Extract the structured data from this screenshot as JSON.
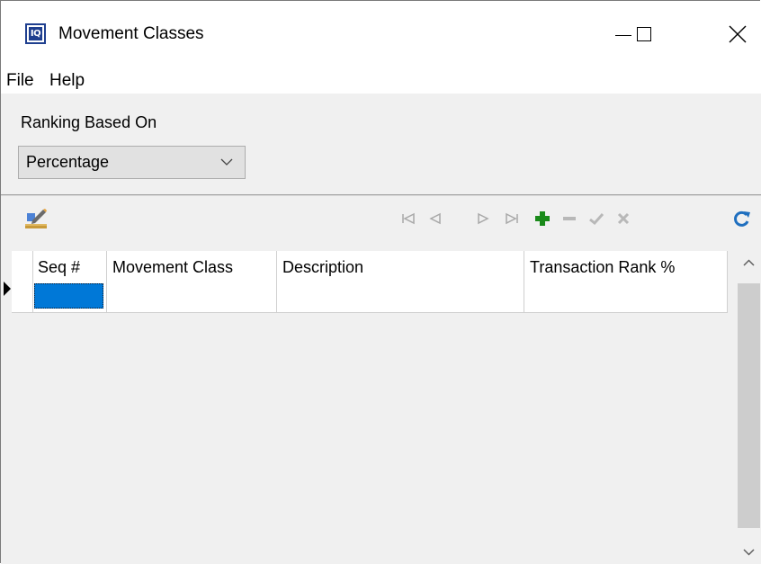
{
  "window": {
    "title": "Movement Classes",
    "app_icon_text": "IQ",
    "controls": {
      "minimize_icon": "minimize-icon",
      "maximize_icon": "maximize-icon",
      "close_icon": "close-icon"
    }
  },
  "menu": {
    "items": [
      {
        "label": "File"
      },
      {
        "label": "Help"
      }
    ]
  },
  "filter": {
    "label": "Ranking Based On",
    "combo_value": "Percentage",
    "combo_arrow_icon": "chevron-down-icon"
  },
  "toolbar": {
    "edit_icon": "edit-grid-icon",
    "nav_icons": [
      "first-record-icon",
      "prev-record-icon",
      "next-record-icon",
      "last-record-icon",
      "add-record-icon",
      "delete-record-icon",
      "post-record-icon",
      "cancel-record-icon",
      "refresh-icon"
    ],
    "colors": {
      "add": "#1a8a1a",
      "refresh": "#1f6fbf",
      "disabled": "#a8a8a8"
    }
  },
  "grid": {
    "columns": [
      {
        "label": "Seq #"
      },
      {
        "label": "Movement Class"
      },
      {
        "label": "Description"
      },
      {
        "label": "Transaction Rank %"
      }
    ],
    "rows": [
      {
        "seq": "",
        "movement_class": "",
        "description": "",
        "transaction_rank": ""
      }
    ],
    "selection_color": "#0078d7"
  }
}
